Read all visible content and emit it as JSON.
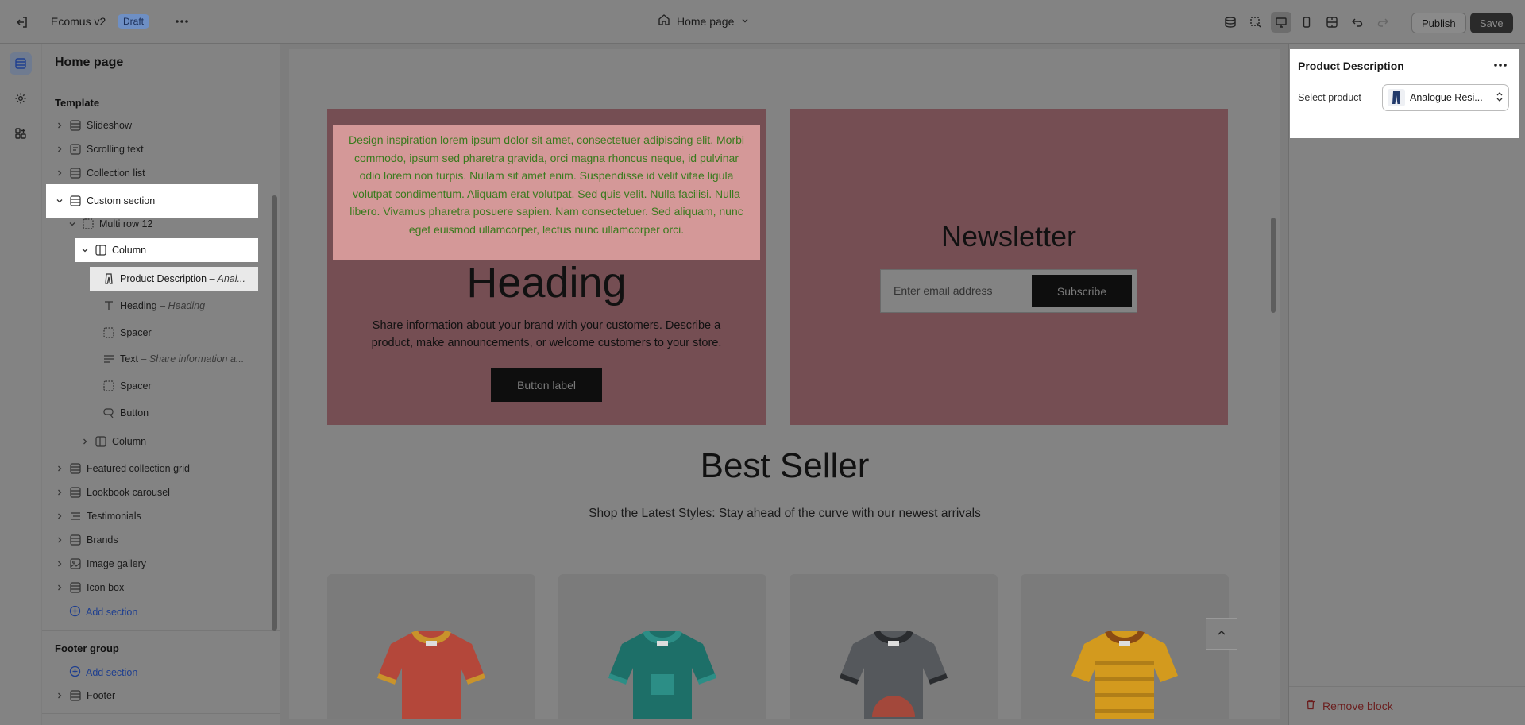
{
  "topbar": {
    "app_title": "Ecomus v2",
    "draft_badge": "Draft",
    "page_selector": "Home page",
    "publish_label": "Publish",
    "save_label": "Save"
  },
  "left_panel": {
    "title": "Home page",
    "template_label": "Template",
    "tree": [
      {
        "label": "Slideshow",
        "icon": "section-icon"
      },
      {
        "label": "Scrolling text",
        "icon": "text-section-icon"
      },
      {
        "label": "Collection list",
        "icon": "section-icon"
      },
      {
        "label": "Custom section",
        "icon": "section-icon"
      },
      {
        "label": "Multi row 12",
        "icon": "row-icon"
      },
      {
        "label": "Column",
        "icon": "column-icon"
      },
      {
        "label": "Product Description",
        "sub": "– Anal...",
        "icon": "jeans-icon"
      },
      {
        "label": "Heading",
        "sub": "– Heading",
        "icon": "heading-icon"
      },
      {
        "label": "Spacer",
        "icon": "spacer-icon"
      },
      {
        "label": "Text",
        "sub": "– Share information a...",
        "icon": "text-icon"
      },
      {
        "label": "Spacer",
        "icon": "spacer-icon"
      },
      {
        "label": "Button",
        "icon": "button-icon"
      },
      {
        "label": "Column",
        "icon": "column-icon"
      },
      {
        "label": "Featured collection grid",
        "icon": "section-icon"
      },
      {
        "label": "Lookbook carousel",
        "icon": "section-icon"
      },
      {
        "label": "Testimonials",
        "icon": "list-icon"
      },
      {
        "label": "Brands",
        "icon": "section-icon"
      },
      {
        "label": "Image gallery",
        "icon": "image-icon"
      },
      {
        "label": "Icon box",
        "icon": "section-icon"
      }
    ],
    "add_section": "Add section",
    "footer_group_label": "Footer group",
    "footer_add_section": "Add section",
    "footer_item": "Footer"
  },
  "canvas": {
    "product_description": "Design inspiration lorem ipsum dolor sit amet, consectetuer adipiscing elit. Morbi commodo, ipsum sed pharetra gravida, orci magna rhoncus neque, id pulvinar odio lorem non turpis. Nullam sit amet enim. Suspendisse id velit vitae ligula volutpat condimentum. Aliquam erat volutpat. Sed quis velit. Nulla facilisi. Nulla libero. Vivamus pharetra posuere sapien. Nam consectetuer. Sed aliquam, nunc eget euismod ullamcorper, lectus nunc ullamcorper orci.",
    "heading": "Heading",
    "text": "Share information about your brand with your customers. Describe a product, make announcements, or welcome customers to your store.",
    "button_label": "Button label",
    "newsletter_title": "Newsletter",
    "email_placeholder": "Enter email address",
    "subscribe_label": "Subscribe",
    "best_seller_title": "Best Seller",
    "best_seller_sub": "Shop the Latest Styles: Stay ahead of the curve with our newest arrivals",
    "products": [
      {
        "name": "red-tshirt",
        "color": "#b4473a",
        "trim": "#c9932b"
      },
      {
        "name": "teal-tshirt",
        "color": "#1d6f68",
        "trim": "#2c8e86"
      },
      {
        "name": "gray-tshirt",
        "color": "#55585c",
        "trim": "#2a2c2f"
      },
      {
        "name": "yellow-striped-tshirt",
        "color": "#d39a1e",
        "trim": "#8a4a14"
      }
    ]
  },
  "right_panel": {
    "title": "Product Description",
    "select_label": "Select product",
    "selected_product": "Analogue Resi...",
    "remove_block": "Remove block"
  },
  "colors": {
    "overlay": "#838383",
    "card_bg": "#754e53",
    "desc_bg": "#d49898",
    "desc_text": "#3a7a1e",
    "remove_text": "#6b1e1e",
    "link": "#1f3f8f"
  }
}
